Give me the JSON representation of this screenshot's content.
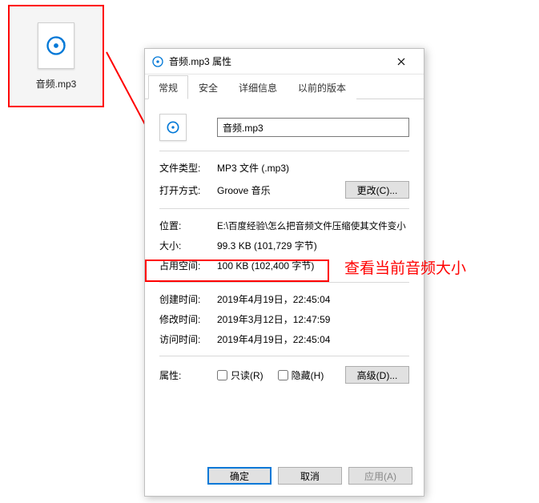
{
  "desktop": {
    "file_label": "音频.mp3"
  },
  "dialog": {
    "title": "音频.mp3 属性",
    "tabs": {
      "general": "常规",
      "security": "安全",
      "details": "详细信息",
      "previous": "以前的版本"
    },
    "filename": "音频.mp3",
    "rows": {
      "type_label": "文件类型:",
      "type_value": "MP3 文件 (.mp3)",
      "open_label": "打开方式:",
      "open_value": "Groove 音乐",
      "change_btn": "更改(C)...",
      "location_label": "位置:",
      "location_value": "E:\\百度经验\\怎么把音频文件压缩使其文件变小",
      "size_label": "大小:",
      "size_value": "99.3 KB (101,729 字节)",
      "disk_label": "占用空间:",
      "disk_value": "100 KB (102,400 字节)",
      "created_label": "创建时间:",
      "created_value": "2019年4月19日，22:45:04",
      "modified_label": "修改时间:",
      "modified_value": "2019年3月12日，12:47:59",
      "accessed_label": "访问时间:",
      "accessed_value": "2019年4月19日，22:45:04",
      "attr_label": "属性:",
      "readonly": "只读(R)",
      "hidden": "隐藏(H)",
      "advanced_btn": "高级(D)..."
    },
    "footer": {
      "ok": "确定",
      "cancel": "取消",
      "apply": "应用(A)"
    }
  },
  "annotation": "查看当前音频大小"
}
